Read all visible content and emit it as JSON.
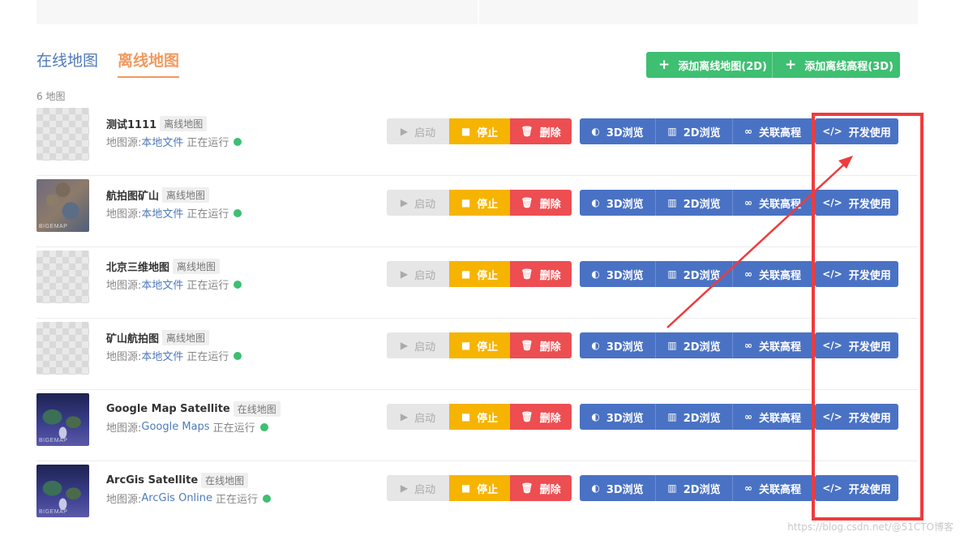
{
  "tabs": {
    "online_label": "在线地图",
    "offline_label": "离线地图"
  },
  "add_buttons": {
    "add_2d": "添加离线地图(2D)",
    "add_3d": "添加离线高程(3D)"
  },
  "map_count": "6 地图",
  "source_prefix": "地图源:",
  "status_text": "正在运行",
  "actions": {
    "start": "启动",
    "stop": "停止",
    "delete": "删除",
    "view3d": "3D浏览",
    "view2d": "2D浏览",
    "link_elevation": "关联高程",
    "developer": "开发使用"
  },
  "maps": [
    {
      "name": "测试1111",
      "tag": "离线地图",
      "source": "本地文件",
      "thumb": "placeholder"
    },
    {
      "name": "航拍图矿山",
      "tag": "离线地图",
      "source": "本地文件",
      "thumb": "aerial",
      "watermark": "BIGEMAP"
    },
    {
      "name": "北京三维地图",
      "tag": "离线地图",
      "source": "本地文件",
      "thumb": "placeholder"
    },
    {
      "name": "矿山航拍图",
      "tag": "离线地图",
      "source": "本地文件",
      "thumb": "placeholder"
    },
    {
      "name": "Google Map Satellite",
      "tag": "在线地图",
      "source": "Google Maps",
      "thumb": "satellite",
      "watermark": "BIGEMAP"
    },
    {
      "name": "ArcGis Satellite",
      "tag": "在线地图",
      "source": "ArcGis Online",
      "thumb": "satellite",
      "watermark": "BIGEMAP"
    }
  ],
  "colors": {
    "accent_orange": "#f19a5f",
    "green": "#3ebf71",
    "blue": "#4a72c4",
    "yellow": "#f6b400",
    "red": "#ec4e52",
    "annotation_red": "#ef3b3d"
  },
  "watermark": "https://blog.csdn.net/@51CTO博客"
}
